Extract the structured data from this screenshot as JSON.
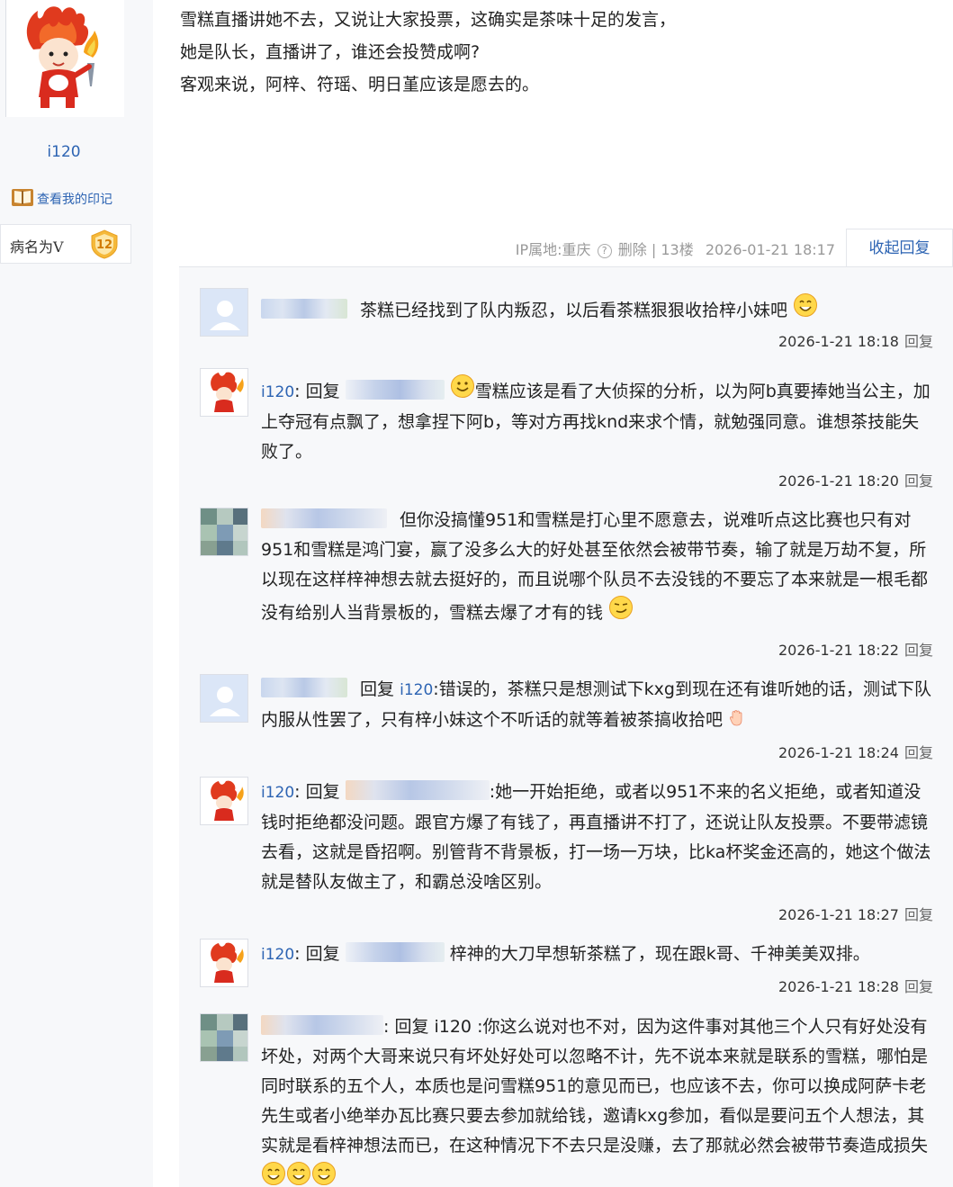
{
  "author": {
    "name": "i120",
    "badge_link": "查看我的印记",
    "level_title": "病名为V",
    "level": "12"
  },
  "post": {
    "lines": [
      "雪糕直播讲她不去，又说让大家投票，这确实是茶味十足的发言，",
      "她是队长，直播讲了，谁还会投赞成啊?",
      "客观来说，阿梓、符瑶、明日堇应该是愿去的。"
    ],
    "ip_label": "IP属地:重庆",
    "delete_label": "删除",
    "floor": "13楼",
    "datetime": "2026-01-21 18:17",
    "collapse_label": "收起回复"
  },
  "replies": [
    {
      "text": "茶糕已经找到了队内叛忍，以后看茶糕狠狠收拾梓小妹吧",
      "time": "2026-1-21 18:18",
      "reply_label": "回复"
    },
    {
      "user": "i120",
      "prefix": ":",
      "reply_word": "回复",
      "text": "雪糕应该是看了大侦探的分析，以为阿b真要捧她当公主，加上夺冠有点飘了，想拿捏下阿b，等对方再找knd来求个情，就勉强同意。谁想茶技能失败了。",
      "time": "2026-1-21 18:20",
      "reply_label": "回复"
    },
    {
      "text": "但你没搞懂951和雪糕是打心里不愿意去，说难听点这比赛也只有对951和雪糕是鸿门宴，赢了没多么大的好处甚至依然会被带节奏，输了就是万劫不复，所以现在这样梓神想去就去挺好的，而且说哪个队员不去没钱的不要忘了本来就是一根毛都没有给别人当背景板的，雪糕去爆了才有的钱",
      "time": "2026-1-21 18:22",
      "reply_label": "回复"
    },
    {
      "reply_word": "回复",
      "reply_to": "i120",
      "text": ":错误的，茶糕只是想测试下kxg到现在还有谁听她的话，测试下队内服从性罢了，只有梓小妹这个不听话的就等着被茶搞收拾吧",
      "time": "2026-1-21 18:24",
      "reply_label": "回复"
    },
    {
      "user": "i120",
      "prefix": ":",
      "reply_word": "回复",
      "text": ":她一开始拒绝，或者以951不来的名义拒绝，或者知道没钱时拒绝都没问题。跟官方爆了有钱了，再直播讲不打了，还说让队友投票。不要带滤镜去看，这就是昏招啊。别管背不背景板，打一场一万块，比ka杯奖金还高的，她这个做法就是替队友做主了，和霸总没啥区别。",
      "time": "2026-1-21 18:27",
      "reply_label": "回复"
    },
    {
      "user": "i120",
      "prefix": ":",
      "reply_word": "回复",
      "text": "梓神的大刀早想斩茶糕了，现在跟k哥、千神美美双排。",
      "time": "2026-1-21 18:28",
      "reply_label": "回复"
    },
    {
      "text": ": 回复 i120 :你这么说对也不对，因为这件事对其他三个人只有好处没有坏处，对两个大哥来说只有坏处好处可以忽略不计，先不说本来就是联系的雪糕，哪怕是同时联系的五个人，本质也是问雪糕951的意见而已，也应该不去，你可以换成阿萨卡老先生或者小绝举办瓦比赛只要去参加就给钱，邀请kxg参加，看似是要问五个人想法，其实就是看梓神想法而已，在这种情况下不去只是没赚，去了那就必然会被带节奏造成损失"
    }
  ]
}
